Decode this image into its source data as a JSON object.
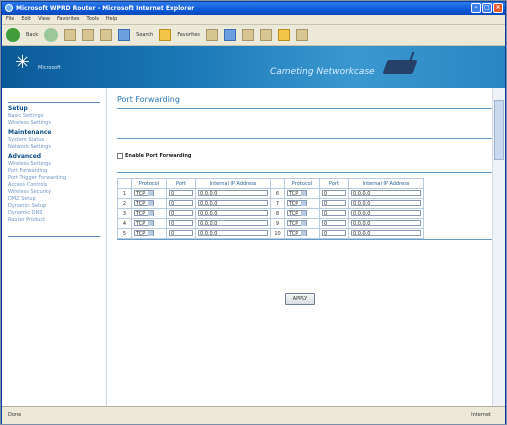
{
  "window": {
    "title": "Microsoft WPRD Router - Microsoft Internet Explorer",
    "menu": [
      "File",
      "Edit",
      "View",
      "Favorites",
      "Tools",
      "Help"
    ],
    "toolbar": {
      "back_label": "Back",
      "search_label": "Search",
      "favorites_label": "Favorites"
    }
  },
  "banner": {
    "brand": "Microsoft",
    "title": "Cameting Networkcase"
  },
  "sidebar": {
    "sections": [
      {
        "title": "Setup",
        "items": [
          "Basic Settings",
          "Wireless Settings"
        ]
      },
      {
        "title": "Maintenance",
        "items": [
          "System Status",
          "Network Settings"
        ]
      },
      {
        "title": "Advanced",
        "items": [
          "Wireless Settings",
          "Port Forwarding",
          "Port Trigger Forwarding",
          "Access Controls",
          "Wireless Security",
          "DMZ Setup",
          "Dynamic Setup",
          "Dynamic DNS",
          "Router Product"
        ]
      }
    ]
  },
  "main": {
    "page_title": "Port Forwarding",
    "enable_label": "Enable Port Forwarding",
    "headers": [
      "Protocol",
      "Port",
      "Internal IP Address",
      "Protocol",
      "Port",
      "Internal IP Address"
    ],
    "rows_left": [
      {
        "num": "1",
        "protocol": "TCP",
        "port": "0",
        "ip": "0.0.0.0"
      },
      {
        "num": "2",
        "protocol": "TCP",
        "port": "0",
        "ip": "0.0.0.0"
      },
      {
        "num": "3",
        "protocol": "TCP",
        "port": "0",
        "ip": "0.0.0.0"
      },
      {
        "num": "4",
        "protocol": "TCP",
        "port": "0",
        "ip": "0.0.0.0"
      },
      {
        "num": "5",
        "protocol": "TCP",
        "port": "0",
        "ip": "0.0.0.0"
      }
    ],
    "rows_right": [
      {
        "num": "6",
        "protocol": "TCP",
        "port": "0",
        "ip": "0.0.0.0"
      },
      {
        "num": "7",
        "protocol": "TCP",
        "port": "0",
        "ip": "0.0.0.0"
      },
      {
        "num": "8",
        "protocol": "TCP",
        "port": "0",
        "ip": "0.0.0.0"
      },
      {
        "num": "9",
        "protocol": "TCP",
        "port": "0",
        "ip": "0.0.0.0"
      },
      {
        "num": "10",
        "protocol": "TCP",
        "port": "0",
        "ip": "0.0.0.0"
      }
    ],
    "apply_label": "APPLY"
  },
  "statusbar": {
    "left": "Done",
    "right": "Internet"
  }
}
